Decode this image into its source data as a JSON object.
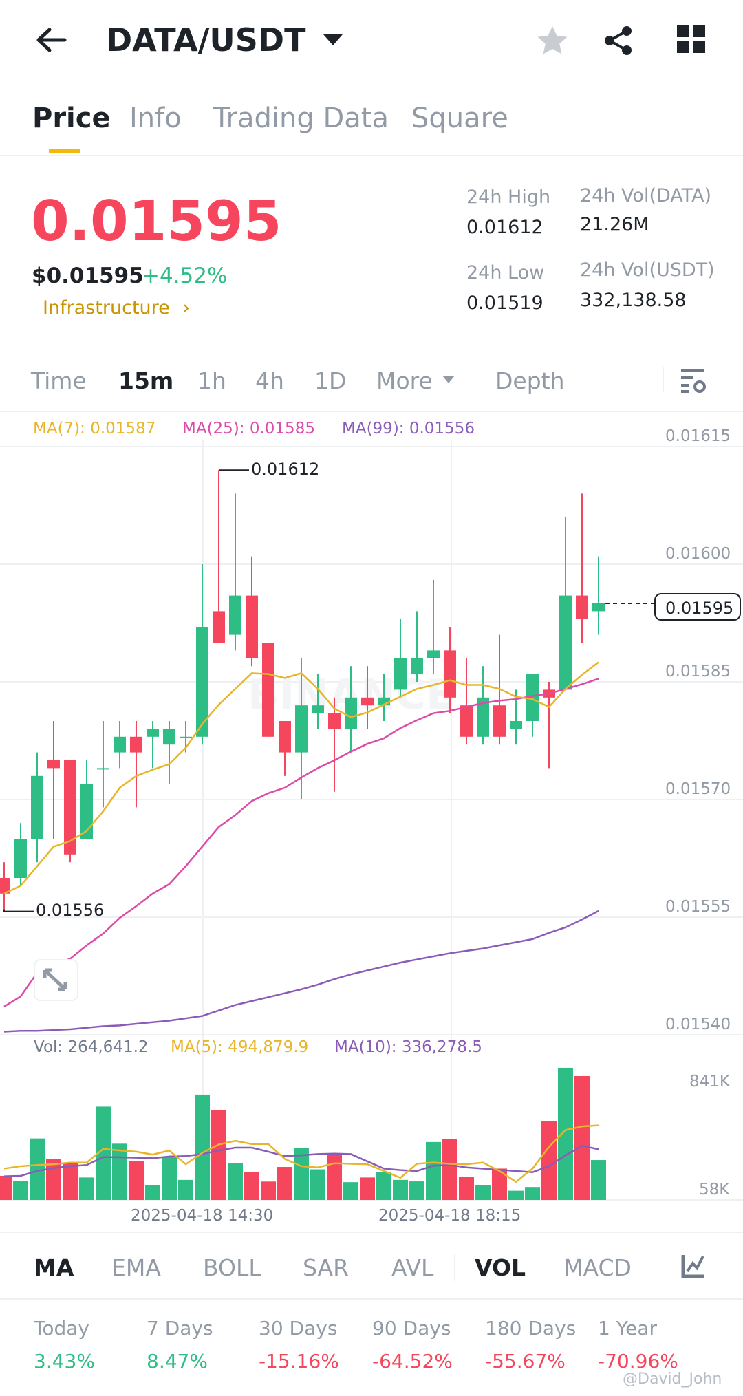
{
  "header": {
    "title": "DATA/USDT",
    "back_icon": "arrow-left-icon",
    "dropdown_icon": "caret-down-icon",
    "star_icon": "star-icon",
    "share_icon": "share-icon",
    "grid_icon": "grid-icon"
  },
  "tabs": [
    {
      "label": "Price",
      "active": true
    },
    {
      "label": "Info"
    },
    {
      "label": "Trading Data"
    },
    {
      "label": "Square"
    }
  ],
  "price": {
    "last": "0.01595",
    "usd": "$0.01595",
    "change": "+4.52%",
    "category": "Infrastructure",
    "category_chevron": "›"
  },
  "stats": {
    "high_label": "24h High",
    "high": "0.01612",
    "low_label": "24h Low",
    "low": "0.01519",
    "vol_base_label": "24h Vol(DATA)",
    "vol_base": "21.26M",
    "vol_quote_label": "24h Vol(USDT)",
    "vol_quote": "332,138.58"
  },
  "intervals": {
    "items": [
      "Time",
      "15m",
      "1h",
      "4h",
      "1D",
      "More",
      "Depth"
    ],
    "active": "15m"
  },
  "ma_legend": {
    "ma7": "MA(7): 0.01587",
    "ma25": "MA(25): 0.01585",
    "ma99": "MA(99): 0.01556"
  },
  "price_axis": [
    "0.01615",
    "0.01600",
    "0.01585",
    "0.01570",
    "0.01555",
    "0.01540"
  ],
  "annotations": {
    "high": "0.01612",
    "low": "0.01556",
    "current": "0.01595"
  },
  "vol_legend": {
    "vol": "Vol: 264,641.2",
    "ma5": "MA(5): 494,879.9",
    "ma10": "MA(10): 336,278.5"
  },
  "vol_axis": {
    "top": "841K",
    "bottom": "58K"
  },
  "time_axis": [
    "2025-04-18 14:30",
    "2025-04-18 18:15"
  ],
  "indicators": [
    "MA",
    "EMA",
    "BOLL",
    "SAR",
    "AVL",
    "VOL",
    "MACD"
  ],
  "performance": [
    {
      "label": "Today",
      "value": "3.43%"
    },
    {
      "label": "7 Days",
      "value": "8.47%"
    },
    {
      "label": "30 Days",
      "value": "-15.16%"
    },
    {
      "label": "90 Days",
      "value": "-64.52%"
    },
    {
      "label": "180 Days",
      "value": "-55.67%"
    },
    {
      "label": "1 Year",
      "value": "-70.96%"
    }
  ],
  "watermark": "@David_John",
  "colors": {
    "up": "#2EBD85",
    "down": "#F6465D",
    "ma7": "#E8B52A",
    "ma25": "#DC4BA8",
    "ma99": "#8A5CB8",
    "accent": "#F0B90B",
    "gold": "#C99400"
  },
  "chart_data": {
    "type": "candlestick",
    "interval": "15m",
    "ylim": [
      0.0154,
      0.01615
    ],
    "candles": [
      [
        0.0156,
        0.01562,
        0.01556,
        0.01558
      ],
      [
        0.0156,
        0.01567,
        0.01559,
        0.01565
      ],
      [
        0.01565,
        0.01576,
        0.01562,
        0.01573
      ],
      [
        0.01575,
        0.0158,
        0.01565,
        0.01574
      ],
      [
        0.01575,
        0.01575,
        0.01562,
        0.01563
      ],
      [
        0.01565,
        0.01575,
        0.01565,
        0.01572
      ],
      [
        0.01574,
        0.0158,
        0.01569,
        0.01574
      ],
      [
        0.01576,
        0.0158,
        0.01574,
        0.01578
      ],
      [
        0.01578,
        0.0158,
        0.01569,
        0.01576
      ],
      [
        0.01578,
        0.0158,
        0.01574,
        0.01579
      ],
      [
        0.01577,
        0.0158,
        0.01572,
        0.01579
      ],
      [
        0.01578,
        0.0158,
        0.01576,
        0.01578
      ],
      [
        0.01578,
        0.016,
        0.01577,
        0.01592
      ],
      [
        0.01594,
        0.01612,
        0.0159,
        0.0159
      ],
      [
        0.01591,
        0.01609,
        0.01589,
        0.01596
      ],
      [
        0.01596,
        0.01601,
        0.01587,
        0.01588
      ],
      [
        0.0159,
        0.0159,
        0.01578,
        0.01578
      ],
      [
        0.0158,
        0.0158,
        0.01573,
        0.01576
      ],
      [
        0.01576,
        0.01588,
        0.0157,
        0.01582
      ],
      [
        0.01581,
        0.01586,
        0.01579,
        0.01582
      ],
      [
        0.01581,
        0.01583,
        0.01571,
        0.01579
      ],
      [
        0.01579,
        0.01587,
        0.01576,
        0.01583
      ],
      [
        0.01583,
        0.01587,
        0.01579,
        0.01582
      ],
      [
        0.01582,
        0.01586,
        0.0158,
        0.01583
      ],
      [
        0.01584,
        0.01593,
        0.01583,
        0.01588
      ],
      [
        0.01586,
        0.01594,
        0.01585,
        0.01588
      ],
      [
        0.01588,
        0.01598,
        0.01586,
        0.01589
      ],
      [
        0.01589,
        0.01592,
        0.01581,
        0.01583
      ],
      [
        0.01582,
        0.01588,
        0.01577,
        0.01578
      ],
      [
        0.01578,
        0.01587,
        0.01577,
        0.01583
      ],
      [
        0.01582,
        0.01591,
        0.01577,
        0.01578
      ],
      [
        0.01579,
        0.01584,
        0.01577,
        0.0158
      ],
      [
        0.0158,
        0.01586,
        0.01578,
        0.01586
      ],
      [
        0.01584,
        0.01585,
        0.01574,
        0.01583
      ],
      [
        0.01584,
        0.01606,
        0.01584,
        0.01596
      ],
      [
        0.01596,
        0.01609,
        0.0159,
        0.01593
      ],
      [
        0.01594,
        0.01601,
        0.01591,
        0.01595
      ]
    ],
    "ma7": [
      0.01558,
      0.01559,
      0.015615,
      0.01564,
      0.015647,
      0.01566,
      0.015685,
      0.015715,
      0.01573,
      0.015738,
      0.015745,
      0.015766,
      0.015796,
      0.015821,
      0.015841,
      0.015861,
      0.01586,
      0.015855,
      0.015861,
      0.015841,
      0.015816,
      0.015805,
      0.015811,
      0.015821,
      0.015831,
      0.015841,
      0.015846,
      0.015852,
      0.015846,
      0.015846,
      0.015841,
      0.015831,
      0.015828,
      0.015818,
      0.015841,
      0.015859,
      0.015875
    ],
    "ma25": [
      0.015436,
      0.015449,
      0.015479,
      0.015489,
      0.015497,
      0.015514,
      0.015529,
      0.015549,
      0.015564,
      0.01558,
      0.015592,
      0.015615,
      0.01564,
      0.015665,
      0.01568,
      0.015698,
      0.015708,
      0.015715,
      0.015728,
      0.01574,
      0.01575,
      0.015761,
      0.015771,
      0.015778,
      0.015791,
      0.015801,
      0.01581,
      0.015813,
      0.015818,
      0.015823,
      0.015826,
      0.015828,
      0.015832,
      0.015835,
      0.015841,
      0.015847,
      0.015854
    ],
    "ma99": [
      0.015404,
      0.015405,
      0.015405,
      0.015406,
      0.015407,
      0.015409,
      0.015411,
      0.015412,
      0.015414,
      0.015416,
      0.015418,
      0.015421,
      0.015424,
      0.015431,
      0.015438,
      0.015443,
      0.015448,
      0.015453,
      0.015458,
      0.015464,
      0.015471,
      0.015477,
      0.015482,
      0.015487,
      0.015492,
      0.015496,
      0.0155,
      0.015504,
      0.015507,
      0.01551,
      0.015514,
      0.015518,
      0.015522,
      0.01553,
      0.015537,
      0.015547,
      0.015558
    ],
    "volume": [
      160000,
      128000,
      408000,
      272000,
      248000,
      149000,
      619000,
      373000,
      259000,
      96000,
      288000,
      133000,
      699000,
      595000,
      246000,
      184000,
      122000,
      219000,
      344000,
      203000,
      309000,
      118000,
      149000,
      184000,
      133000,
      123000,
      384000,
      406000,
      155000,
      98000,
      208000,
      61000,
      86000,
      525000,
      877000,
      822000,
      264641
    ],
    "vol_ma5": [
      208000,
      224000,
      232000,
      237000,
      248000,
      248000,
      339000,
      328000,
      320000,
      301000,
      328000,
      237000,
      312000,
      368000,
      392000,
      371000,
      371000,
      272000,
      224000,
      216000,
      243000,
      240000,
      237000,
      192000,
      147000,
      240000,
      248000,
      240000,
      237000,
      248000,
      192000,
      120000,
      208000,
      352000,
      464000,
      488000,
      494880
    ],
    "vol_ma10": [
      157000,
      160000,
      192000,
      211000,
      224000,
      232000,
      285000,
      283000,
      280000,
      277000,
      288000,
      291000,
      304000,
      328000,
      347000,
      347000,
      320000,
      291000,
      296000,
      304000,
      307000,
      304000,
      256000,
      208000,
      198000,
      192000,
      227000,
      232000,
      216000,
      208000,
      200000,
      192000,
      184000,
      224000,
      296000,
      360000,
      336279
    ]
  }
}
